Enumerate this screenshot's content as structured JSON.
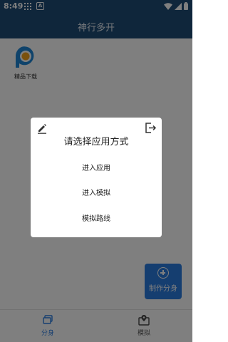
{
  "status_bar": {
    "time": "8:49",
    "icons": [
      "grid-icon",
      "a-notification-icon",
      "wifi-icon",
      "signal-icon",
      "battery-icon"
    ]
  },
  "app_bar": {
    "title": "神行多开"
  },
  "apps": [
    {
      "label": "精品下载",
      "icon": "p-app-icon"
    }
  ],
  "fab": {
    "label": "制作分身",
    "icon": "plus-circle-icon"
  },
  "bottom_nav": {
    "items": [
      {
        "label": "分身",
        "icon": "layers-icon",
        "active": true
      },
      {
        "label": "模拟",
        "icon": "map-pin-icon",
        "active": false
      }
    ]
  },
  "dialog": {
    "title": "请选择应用方式",
    "options": [
      "进入应用",
      "进入模拟",
      "模拟路线"
    ],
    "left_icon": "edit-icon",
    "right_icon": "exit-icon"
  },
  "colors": {
    "primary": "#1e4c77",
    "accent": "#2b7de0",
    "app_icon_blue": "#1f86d6",
    "app_icon_orange": "#f4a31a"
  }
}
